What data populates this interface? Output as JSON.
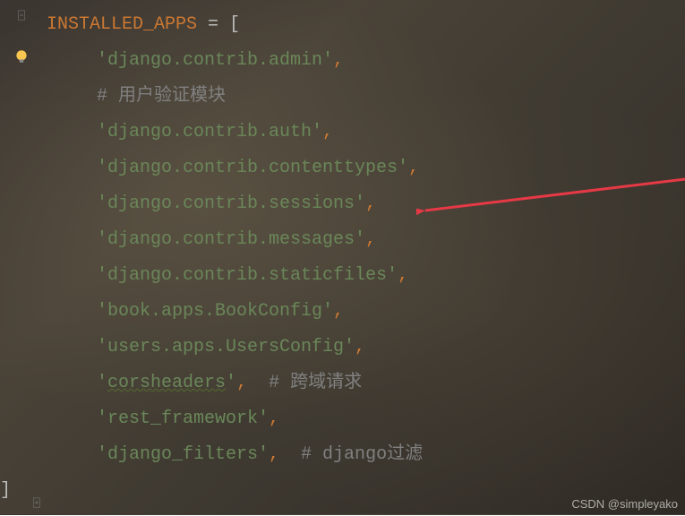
{
  "header": {
    "var_name": "INSTALLED_APPS",
    "assign": " = ["
  },
  "lines": [
    {
      "type": "string",
      "value": "'django.contrib.admin'",
      "comma": true
    },
    {
      "type": "comment",
      "value": "# 用户验证模块"
    },
    {
      "type": "string",
      "value": "'django.contrib.auth'",
      "comma": true
    },
    {
      "type": "string",
      "value": "'django.contrib.contenttypes'",
      "comma": true
    },
    {
      "type": "string",
      "value": "'django.contrib.sessions'",
      "comma": true
    },
    {
      "type": "string",
      "value": "'django.contrib.messages'",
      "comma": true
    },
    {
      "type": "string",
      "value": "'django.contrib.staticfiles'",
      "comma": true
    },
    {
      "type": "string",
      "value": "'book.apps.BookConfig'",
      "comma": true
    },
    {
      "type": "string",
      "value": "'users.apps.UsersConfig'",
      "comma": true
    },
    {
      "type": "string_inline_comment",
      "value": "'",
      "underlined": "corsheaders",
      "suffix": "'",
      "comma": true,
      "comment": "  # 跨域请求"
    },
    {
      "type": "string",
      "value": "'rest_framework'",
      "comma": true
    },
    {
      "type": "string_inline_comment",
      "value": "'django_filters'",
      "comma": true,
      "comment": "  # django过滤"
    }
  ],
  "closing_bracket": "]",
  "watermark": "CSDN @simpleyako"
}
